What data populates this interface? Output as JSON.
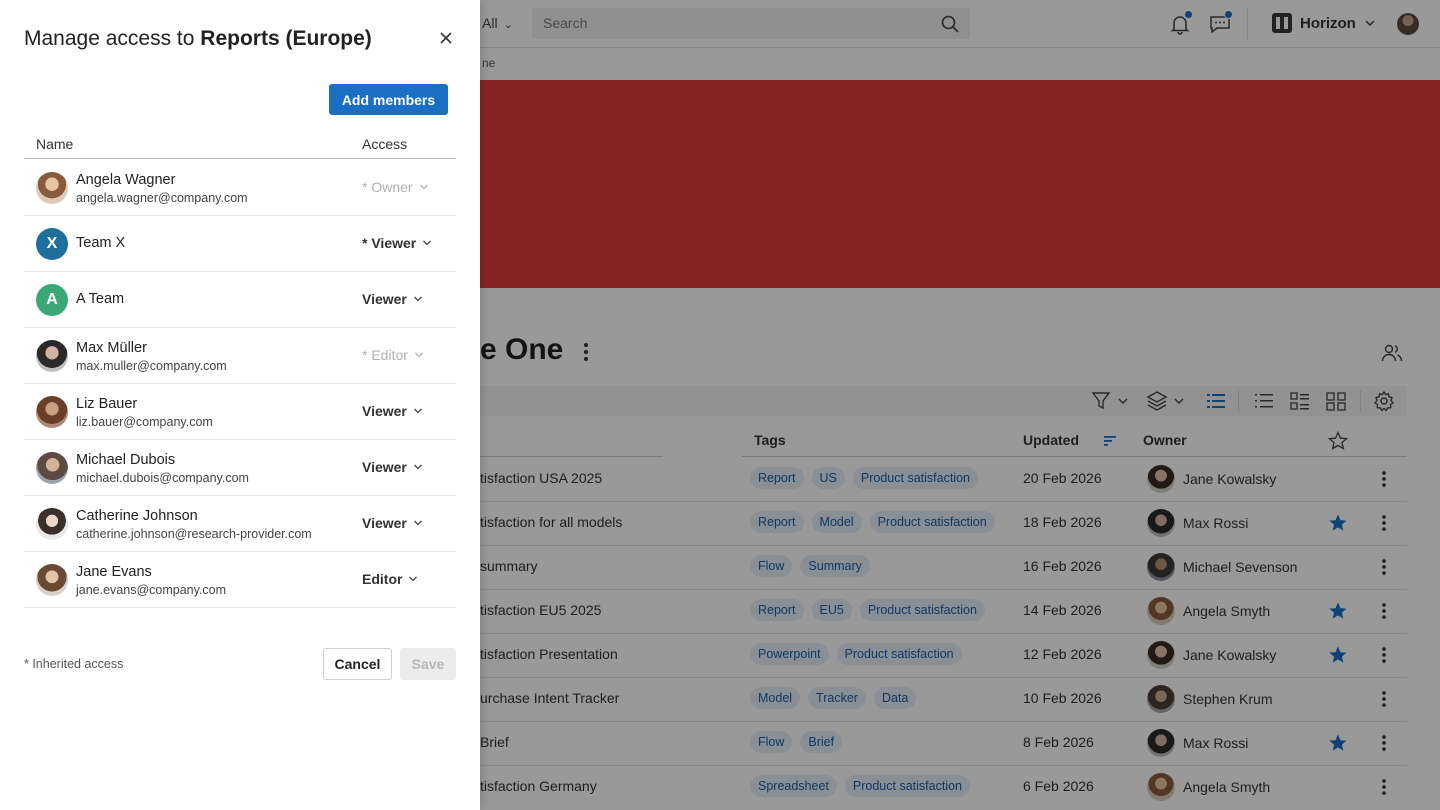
{
  "dialog": {
    "title_prefix": "Manage access to",
    "title_target": "Reports (Europe)",
    "add_members_label": "Add members",
    "col_name": "Name",
    "col_access": "Access",
    "members": [
      {
        "name": "Angela Wagner",
        "email": "angela.wagner@company.com",
        "access": "* Owner",
        "avatar": "photo",
        "disabled": true
      },
      {
        "name": "Team X",
        "email": "",
        "access": "* Viewer",
        "avatar": "letter",
        "letter": "X",
        "color": "#1f6e9c",
        "disabled": false
      },
      {
        "name": "A Team",
        "email": "",
        "access": "Viewer",
        "avatar": "letter",
        "letter": "A",
        "color": "#3aa775",
        "disabled": false
      },
      {
        "name": "Max Müller",
        "email": "max.muller@company.com",
        "access": "* Editor",
        "avatar": "photo",
        "disabled": true
      },
      {
        "name": "Liz Bauer",
        "email": "liz.bauer@company.com",
        "access": "Viewer",
        "avatar": "photo",
        "disabled": false
      },
      {
        "name": "Michael Dubois",
        "email": "michael.dubois@company.com",
        "access": "Viewer",
        "avatar": "photo",
        "disabled": false
      },
      {
        "name": "Catherine Johnson",
        "email": "catherine.johnson@research-provider.com",
        "access": "Viewer",
        "avatar": "photo",
        "disabled": false
      },
      {
        "name": "Jane Evans",
        "email": "jane.evans@company.com",
        "access": "Editor",
        "avatar": "photo",
        "disabled": false
      }
    ],
    "footnote": "* Inherited access",
    "cancel_label": "Cancel",
    "save_label": "Save"
  },
  "topbar": {
    "scope_label": "All",
    "search_placeholder": "Search",
    "brand_name": "Horizon"
  },
  "breadcrumb_tail": "ne",
  "page": {
    "title_visible": "e One"
  },
  "table": {
    "headers": {
      "tags": "Tags",
      "updated": "Updated",
      "owner": "Owner"
    },
    "rows": [
      {
        "title": "tisfaction USA 2025",
        "tags": [
          "Report",
          "US",
          "Product satisfaction"
        ],
        "updated": "20 Feb 2026",
        "owner": "Jane Kowalsky",
        "starred": false
      },
      {
        "title": "tisfaction for all models",
        "tags": [
          "Report",
          "Model",
          "Product satisfaction"
        ],
        "updated": "18 Feb 2026",
        "owner": "Max Rossi",
        "starred": true
      },
      {
        "title": "summary",
        "tags": [
          "Flow",
          "Summary"
        ],
        "updated": "16 Feb 2026",
        "owner": "Michael Sevenson",
        "starred": false
      },
      {
        "title": "tisfaction EU5 2025",
        "tags": [
          "Report",
          "EU5",
          "Product satisfaction"
        ],
        "updated": "14 Feb 2026",
        "owner": "Angela Smyth",
        "starred": true
      },
      {
        "title": "tisfaction Presentation",
        "tags": [
          "Powerpoint",
          "Product satisfaction"
        ],
        "updated": "12 Feb 2026",
        "owner": "Jane Kowalsky",
        "starred": true
      },
      {
        "title": "urchase Intent Tracker",
        "tags": [
          "Model",
          "Tracker",
          "Data"
        ],
        "updated": "10 Feb 2026",
        "owner": "Stephen Krum",
        "starred": false
      },
      {
        "title": "Brief",
        "tags": [
          "Flow",
          "Brief"
        ],
        "updated": "8 Feb 2026",
        "owner": "Max Rossi",
        "starred": true
      },
      {
        "title": "tisfaction Germany",
        "tags": [
          "Spreadsheet",
          "Product satisfaction"
        ],
        "updated": "6 Feb 2026",
        "owner": "Angela Smyth",
        "starred": false
      }
    ]
  },
  "colors": {
    "accent": "#1a6fc4",
    "hero": "#e03c3e",
    "star": "#1a6fc4",
    "tag_text": "#1a5ea6",
    "tag_bg": "#e4eef9"
  }
}
